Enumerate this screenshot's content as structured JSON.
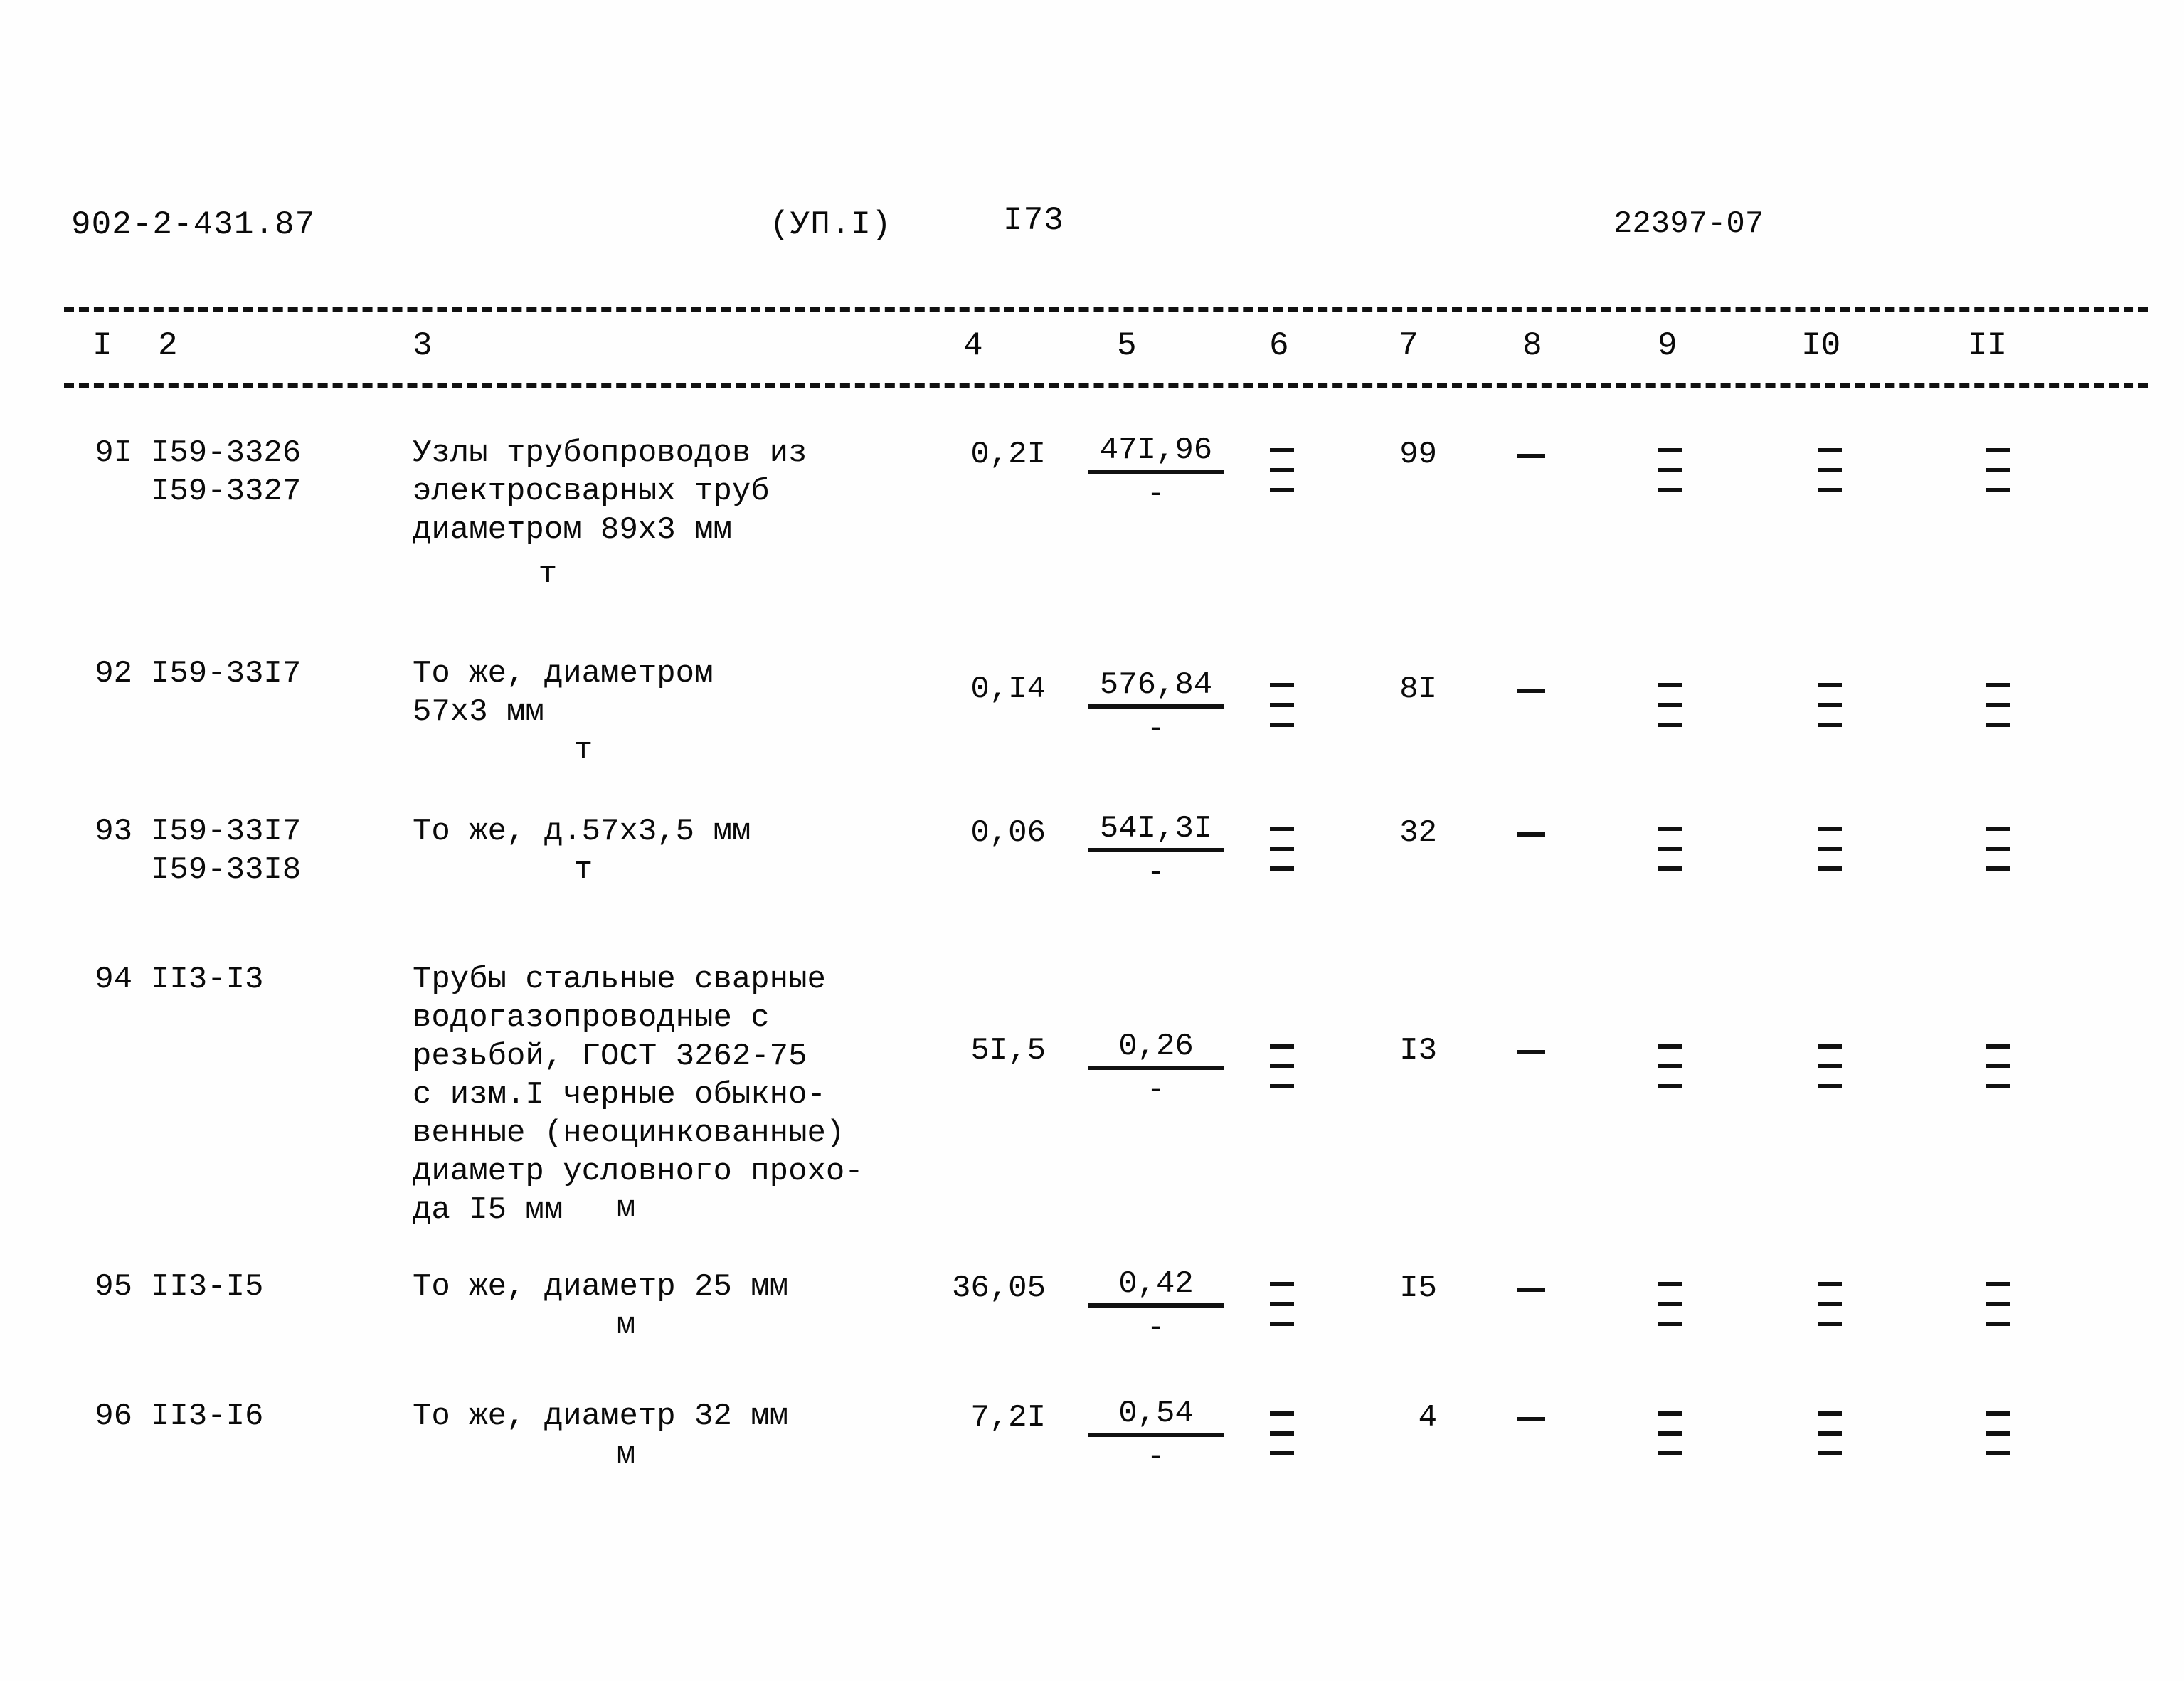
{
  "document": {
    "code": "902-2-431.87",
    "section": "(УП.I)",
    "page_number": "I73",
    "reference": "22397-07"
  },
  "table": {
    "column_headers": [
      "I",
      "2",
      "3",
      "4",
      "5",
      "6",
      "7",
      "8",
      "9",
      "I0",
      "II"
    ],
    "rows": [
      {
        "no": "9I",
        "codes": "I59-3326\nI59-3327",
        "description": "Узлы трубопроводов из\nэлектросварных труб\nдиаметром 89х3 мм",
        "unit": "т",
        "col4": "0,2I",
        "col5_num": "47I,96",
        "col5_den": "-",
        "col6": "dash-stack",
        "col7": "99",
        "col8": "-",
        "col9": "dash-stack",
        "col10": "dash-stack",
        "col11": "dash-stack"
      },
      {
        "no": "92",
        "codes": "I59-33I7",
        "description": "То же, диаметром\n57х3 мм",
        "unit": "т",
        "col4": "0,I4",
        "col5_num": "576,84",
        "col5_den": "-",
        "col6": "dash-stack",
        "col7": "8I",
        "col8": "-",
        "col9": "dash-stack",
        "col10": "dash-stack",
        "col11": "dash-stack"
      },
      {
        "no": "93",
        "codes": "I59-33I7\nI59-33I8",
        "description": "То же, д.57х3,5 мм",
        "unit": "т",
        "col4": "0,06",
        "col5_num": "54I,3I",
        "col5_den": "-",
        "col6": "dash-stack",
        "col7": "32",
        "col8": "-",
        "col9": "dash-stack",
        "col10": "dash-stack",
        "col11": "dash-stack"
      },
      {
        "no": "94",
        "codes": "II3-I3",
        "description": "Трубы стальные сварные\nводогазопроводные с\nрезьбой, ГОСТ 3262-75\nс изм.I черные обыкно-\nвенные (неоцинкованные)\nдиаметр условного прохо-\nда I5 мм",
        "unit": "м",
        "col4": "5I,5",
        "col5_num": "0,26",
        "col5_den": "-",
        "col6": "dash-stack",
        "col7": "I3",
        "col8": "-",
        "col9": "dash-stack",
        "col10": "dash-stack",
        "col11": "dash-stack"
      },
      {
        "no": "95",
        "codes": "II3-I5",
        "description": "То же, диаметр 25 мм",
        "unit": "м",
        "col4": "36,05",
        "col5_num": "0,42",
        "col5_den": "-",
        "col6": "dash-stack",
        "col7": "I5",
        "col8": "-",
        "col9": "dash-stack",
        "col10": "dash-stack",
        "col11": "dash-stack"
      },
      {
        "no": "96",
        "codes": "II3-I6",
        "description": "То же, диаметр 32 мм",
        "unit": "м",
        "col4": "7,2I",
        "col5_num": "0,54",
        "col5_den": "-",
        "col6": "dash-stack",
        "col7": "4",
        "col8": "-",
        "col9": "dash-stack",
        "col10": "dash-stack",
        "col11": "dash-stack"
      }
    ]
  }
}
